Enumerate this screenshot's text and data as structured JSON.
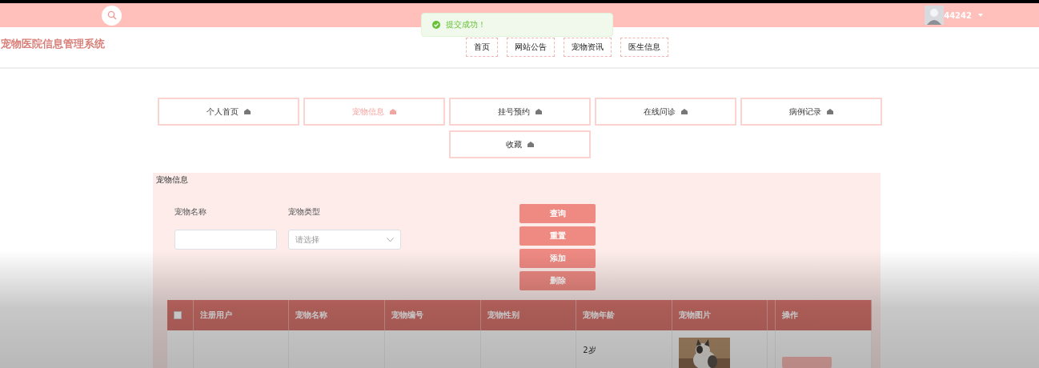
{
  "header": {
    "user": "44242"
  },
  "toast": {
    "message": "提交成功！"
  },
  "site_title": "宠物医院信息管理系统",
  "nav": [
    {
      "label": "首页"
    },
    {
      "label": "网站公告"
    },
    {
      "label": "宠物资讯"
    },
    {
      "label": "医生信息"
    }
  ],
  "menu": [
    {
      "label": "个人首页",
      "selected": false
    },
    {
      "label": "宠物信息",
      "selected": true
    },
    {
      "label": "挂号预约",
      "selected": false
    },
    {
      "label": "在线问诊",
      "selected": false
    },
    {
      "label": "病例记录",
      "selected": false
    },
    {
      "label": "收藏",
      "selected": false
    }
  ],
  "panel": {
    "title": "宠物信息",
    "filters": [
      {
        "label": "宠物名称",
        "kind": "text"
      },
      {
        "label": "宠物类型",
        "kind": "select",
        "placeholder": "请选择"
      }
    ],
    "buttons": [
      "查询",
      "重置",
      "添加",
      "删除"
    ],
    "table": {
      "columns": [
        {
          "kind": "checkbox",
          "checked": false
        },
        {
          "kind": "text",
          "label": "注册用户"
        },
        {
          "kind": "text",
          "label": "宠物名称"
        },
        {
          "kind": "text",
          "label": "宠物编号"
        },
        {
          "kind": "text",
          "label": "宠物性别"
        },
        {
          "kind": "text",
          "label": "宠物年龄"
        },
        {
          "kind": "text",
          "label": "宠物图片"
        },
        {
          "kind": "narrow"
        },
        {
          "kind": "text",
          "label": "操作"
        }
      ],
      "rows": [
        {
          "cells": [
            {
              "kind": "empty"
            },
            {
              "kind": "empty"
            },
            {
              "kind": "empty"
            },
            {
              "kind": "empty"
            },
            {
              "kind": "empty"
            },
            {
              "kind": "text",
              "text": "2岁"
            },
            {
              "kind": "picture"
            },
            {
              "kind": "empty"
            },
            {
              "kind": "button"
            }
          ]
        }
      ]
    }
  }
}
